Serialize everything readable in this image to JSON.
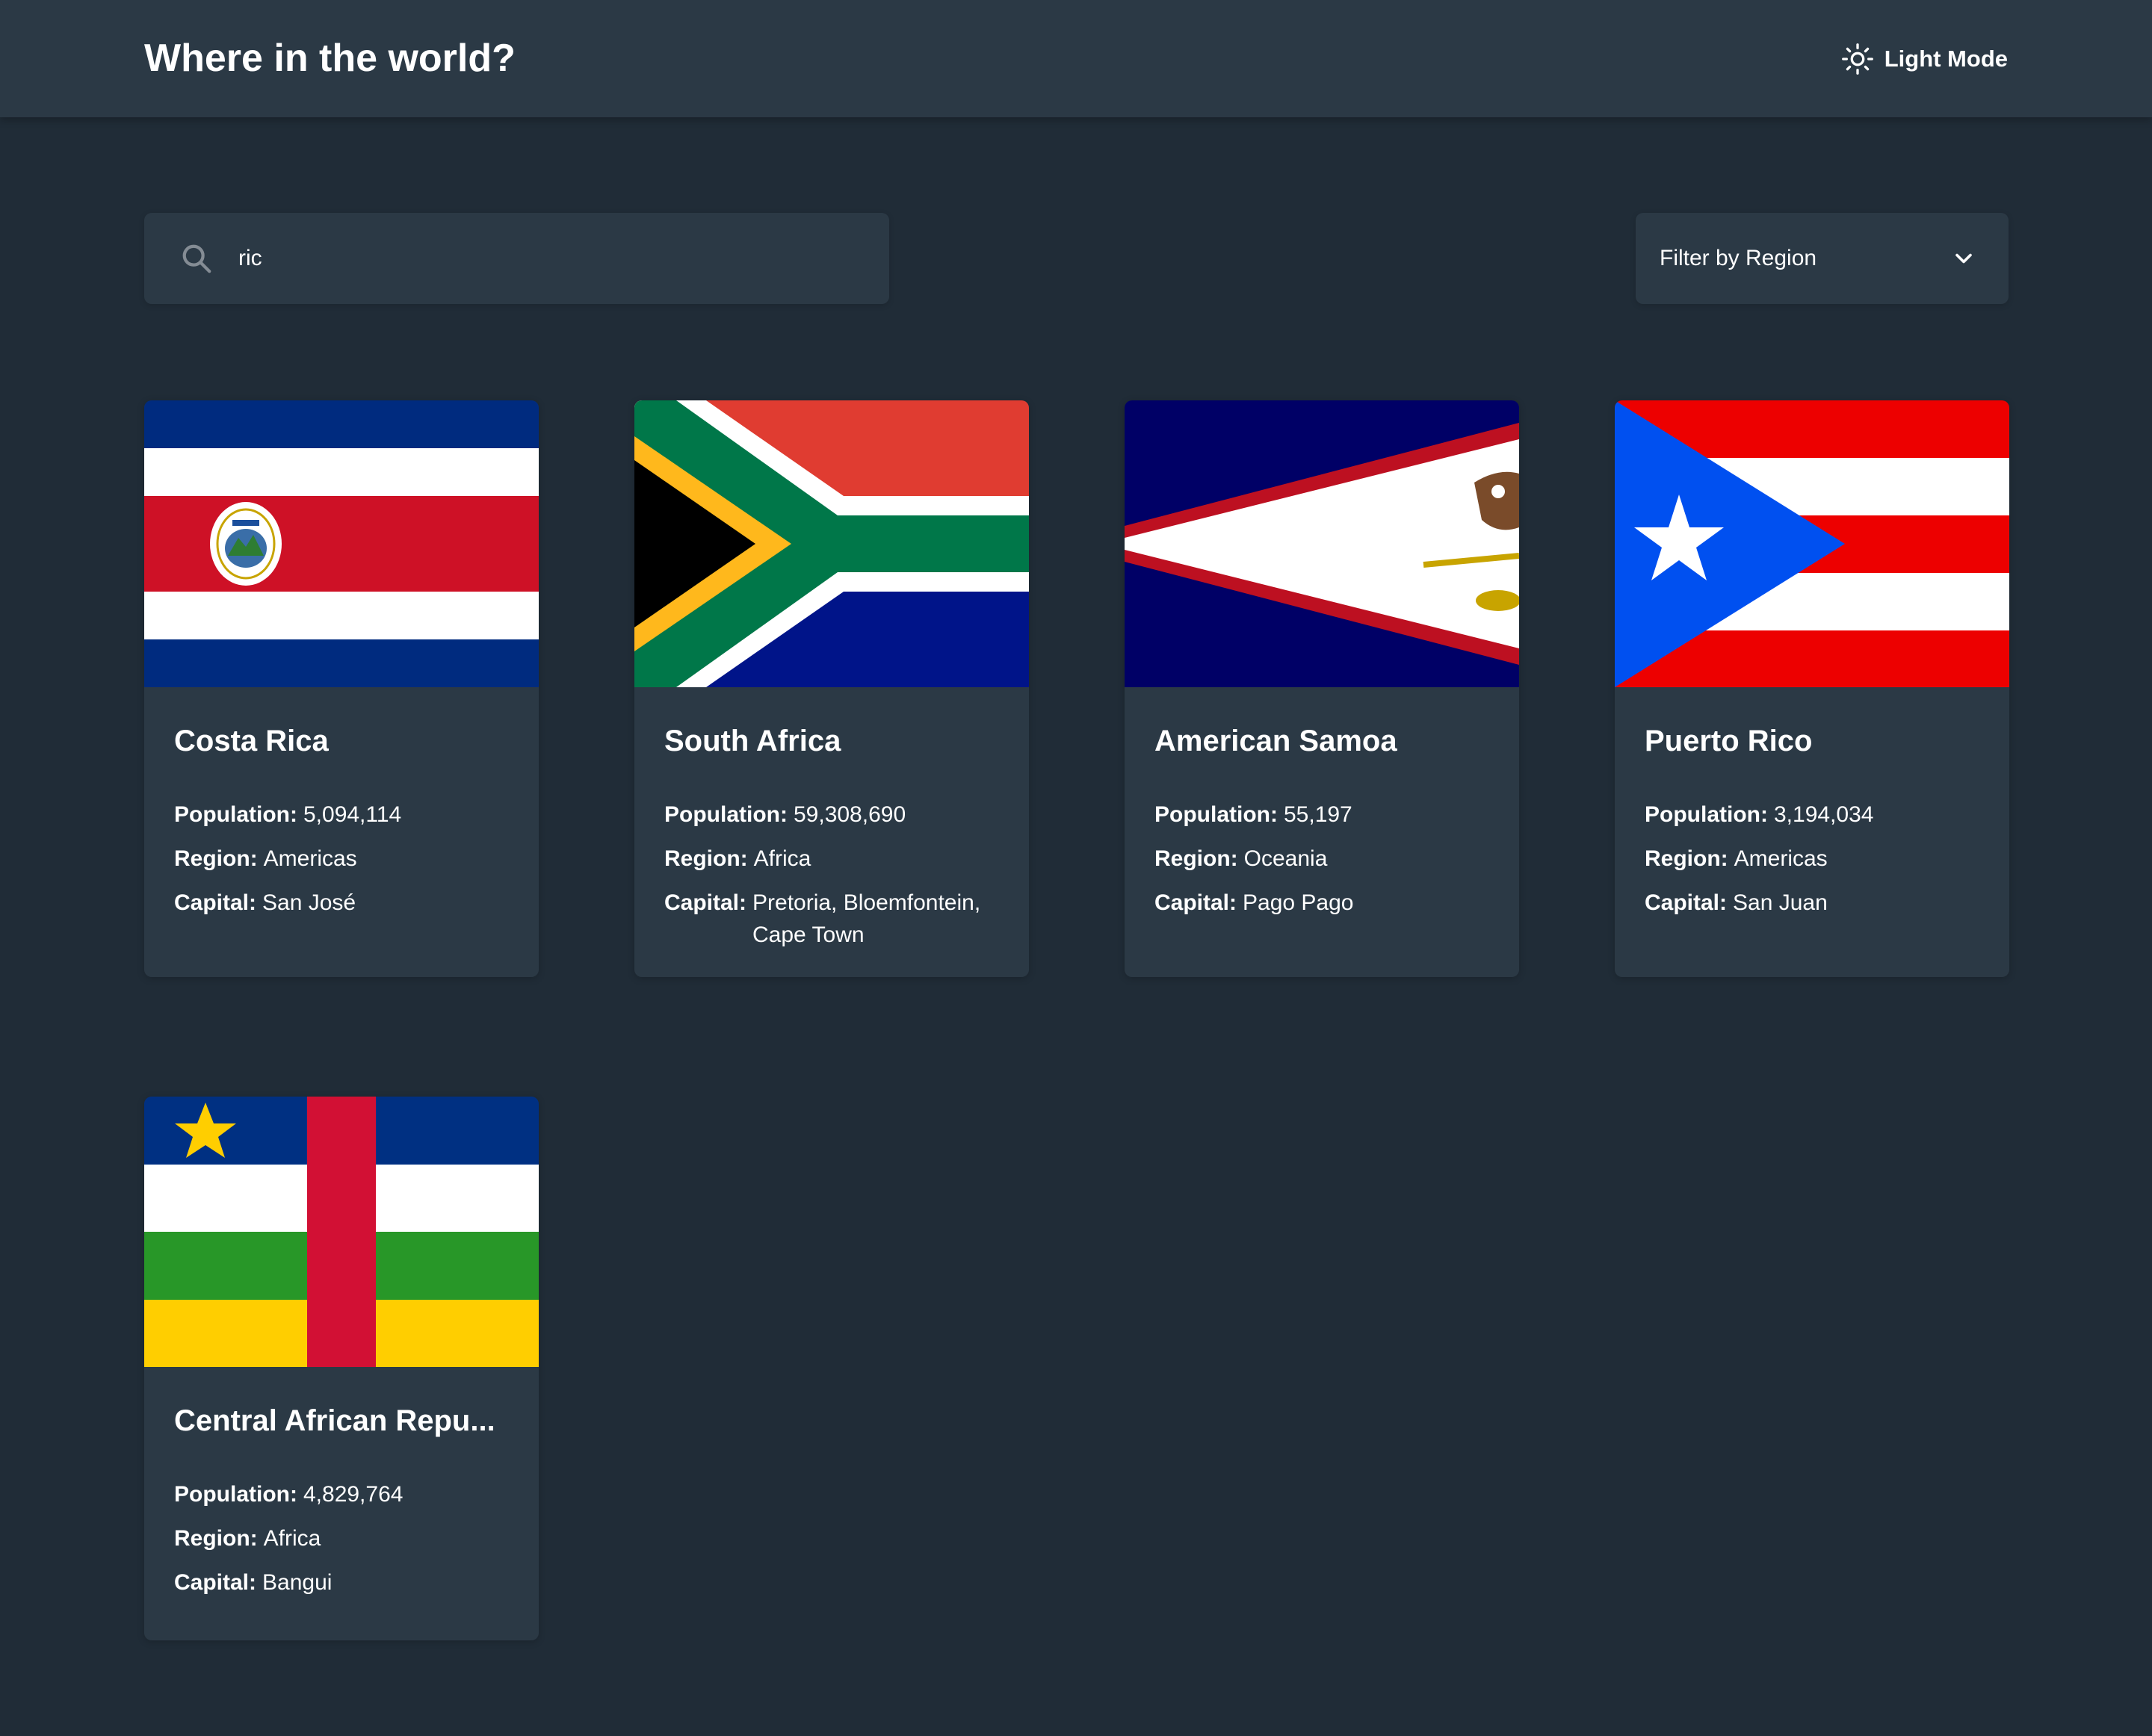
{
  "header": {
    "title": "Where in the world?",
    "theme_toggle_label": "Light Mode",
    "theme_icon": "sun-icon"
  },
  "search": {
    "value": "ric",
    "icon": "search-icon"
  },
  "filter": {
    "label": "Filter by Region",
    "icon": "chevron-down-icon"
  },
  "labels": {
    "population": "Population:",
    "region": "Region:",
    "capital": "Capital:"
  },
  "countries": [
    {
      "name": "Costa Rica",
      "population": "5,094,114",
      "region": "Americas",
      "capital": "San José",
      "flag": "costa-rica-flag"
    },
    {
      "name": "South Africa",
      "population": "59,308,690",
      "region": "Africa",
      "capital": "Pretoria, Bloemfontein, Cape Town",
      "flag": "south-africa-flag"
    },
    {
      "name": "American Samoa",
      "population": "55,197",
      "region": "Oceania",
      "capital": "Pago Pago",
      "flag": "american-samoa-flag"
    },
    {
      "name": "Puerto Rico",
      "population": "3,194,034",
      "region": "Americas",
      "capital": "San Juan",
      "flag": "puerto-rico-flag"
    },
    {
      "name": "Central African Repu...",
      "population": "4,829,764",
      "region": "Africa",
      "capital": "Bangui",
      "flag": "central-african-republic-flag"
    }
  ],
  "colors": {
    "background": "#202c37",
    "element": "#2b3945",
    "text": "#ffffff"
  }
}
